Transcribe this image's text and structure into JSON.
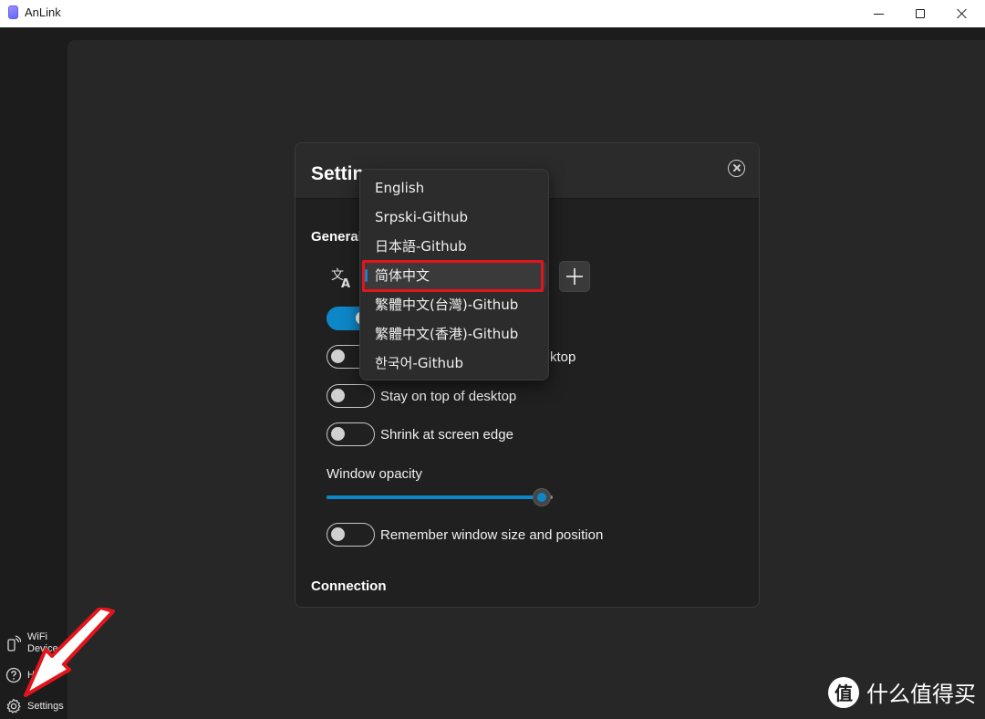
{
  "window": {
    "title": "AnLink"
  },
  "sidebar": {
    "wifi_label": "WiFi Device",
    "help_label": "Help",
    "settings_label": "Settings"
  },
  "dialog": {
    "title": "Settings",
    "general_label": "General",
    "connection_label": "Connection",
    "toggles": [
      {
        "label": "",
        "on": true
      },
      {
        "label": "...ktop",
        "on": false
      },
      {
        "label": "Stay on top of desktop",
        "on": false
      },
      {
        "label": "Shrink at screen edge",
        "on": false
      }
    ],
    "obscured_label_fragment": "ktop",
    "opacity_label": "Window opacity",
    "opacity_value": 0.95,
    "remember_label": "Remember window size and position"
  },
  "language_dropdown": {
    "items": [
      "English",
      "Srpski-Github",
      "日本語-Github",
      "简体中文",
      "繁體中文(台灣)-Github",
      "繁體中文(香港)-Github",
      "한국어-Github"
    ],
    "selected": "简体中文"
  },
  "watermark": {
    "text": "什么值得买",
    "logo_glyph": "值"
  },
  "colors": {
    "accent": "#0e87c8",
    "highlight": "#e2141c",
    "background": "#1c1c1c",
    "panel": "#202020"
  }
}
